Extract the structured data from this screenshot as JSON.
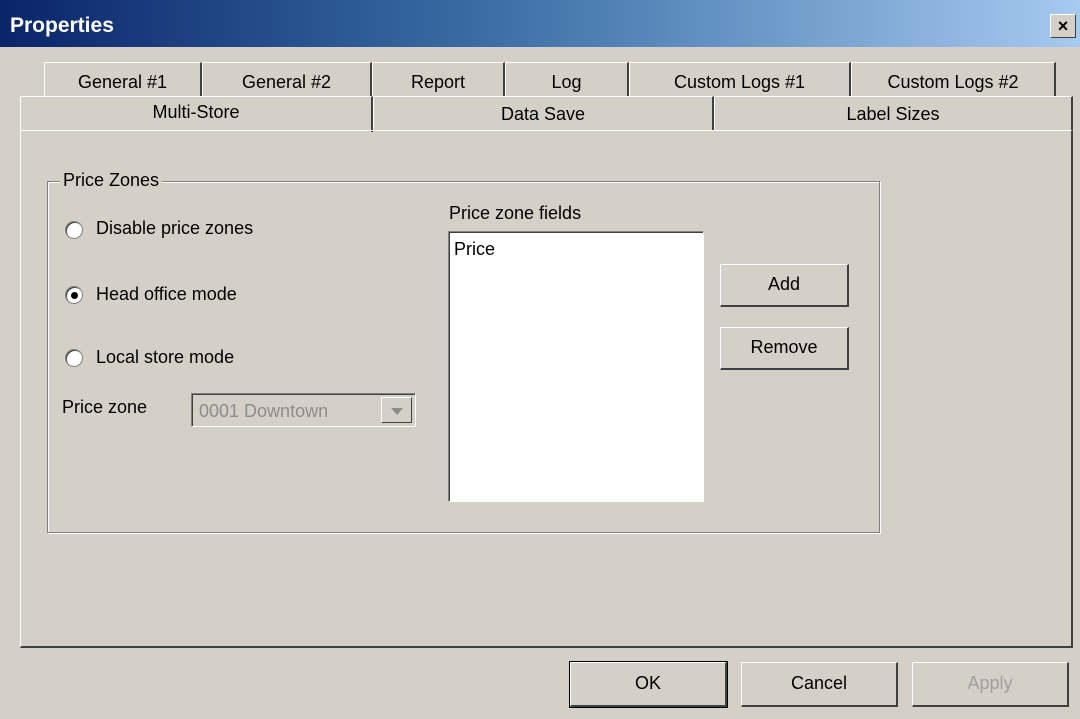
{
  "window": {
    "title": "Properties",
    "close_label": "×"
  },
  "tabs": {
    "row1": [
      "General #1",
      "General #2",
      "Report",
      "Log",
      "Custom Logs #1",
      "Custom Logs #2"
    ],
    "row2": [
      "Multi-Store",
      "Data Save",
      "Label Sizes"
    ],
    "active": "Multi-Store"
  },
  "price_zones": {
    "group_title": "Price Zones",
    "options": [
      "Disable price zones",
      "Head office mode",
      "Local store mode"
    ],
    "selected": "Head office mode",
    "price_zone_label": "Price zone",
    "price_zone_value": "0001  Downtown",
    "fields_label": "Price zone fields",
    "fields": [
      "Price"
    ],
    "add_label": "Add",
    "remove_label": "Remove"
  },
  "footer": {
    "ok_label": "OK",
    "cancel_label": "Cancel",
    "apply_label": "Apply"
  }
}
